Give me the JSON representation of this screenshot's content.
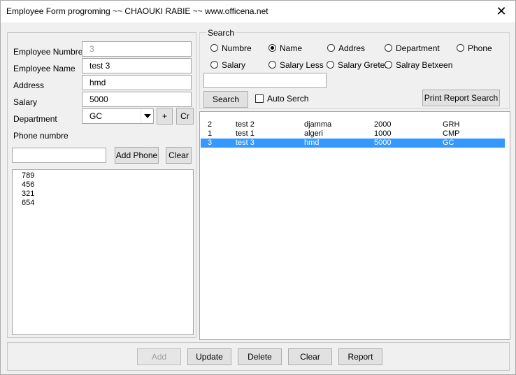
{
  "window": {
    "title": "Employee Form progroming ~~ CHAOUKI RABIE ~~  www.officena.net",
    "close_glyph": "✕"
  },
  "form": {
    "labels": {
      "employee_number": "Employee Numbre",
      "employee_name": "Employee Name",
      "address": "Address",
      "salary": "Salary",
      "department": "Department",
      "phone": "Phone numbre"
    },
    "values": {
      "employee_number": "3",
      "employee_name": "test 3",
      "address": "hmd",
      "salary": "5000",
      "department": "GC",
      "phone_input": ""
    },
    "buttons": {
      "add_dept": "+",
      "create_dept": "Cr",
      "add_phone": "Add Phone",
      "clear_phone": "Clear"
    },
    "phones": [
      "789",
      "456",
      "321",
      "654"
    ]
  },
  "search": {
    "group_title": "Search",
    "options": [
      {
        "label": "Numbre",
        "selected": false
      },
      {
        "label": "Name",
        "selected": true
      },
      {
        "label": "Addres",
        "selected": false
      },
      {
        "label": "Department",
        "selected": false
      },
      {
        "label": "Phone",
        "selected": false
      },
      {
        "label": "Salary",
        "selected": false
      },
      {
        "label": "Salary Less",
        "selected": false
      },
      {
        "label": "Salary Greter",
        "selected": false
      },
      {
        "label": "Salray Betxeen",
        "selected": false
      }
    ],
    "query": "",
    "search_button": "Search",
    "auto_search_label": "Auto Serch",
    "auto_search_checked": false,
    "print_button": "Print Report Search"
  },
  "results": {
    "rows": [
      {
        "id": "2",
        "name": "test 2",
        "address": "djamma",
        "salary": "2000",
        "department": "GRH",
        "selected": false
      },
      {
        "id": "1",
        "name": "test 1",
        "address": "algeri",
        "salary": "1000",
        "department": "CMP",
        "selected": false
      },
      {
        "id": "3",
        "name": "test 3",
        "address": "hmd",
        "salary": "5000",
        "department": "GC",
        "selected": true
      }
    ]
  },
  "footer": {
    "add": "Add",
    "update": "Update",
    "delete": "Delete",
    "clear": "Clear",
    "report": "Report"
  },
  "colors": {
    "selection": "#3399ff",
    "window_bg": "#f0f0f0"
  }
}
